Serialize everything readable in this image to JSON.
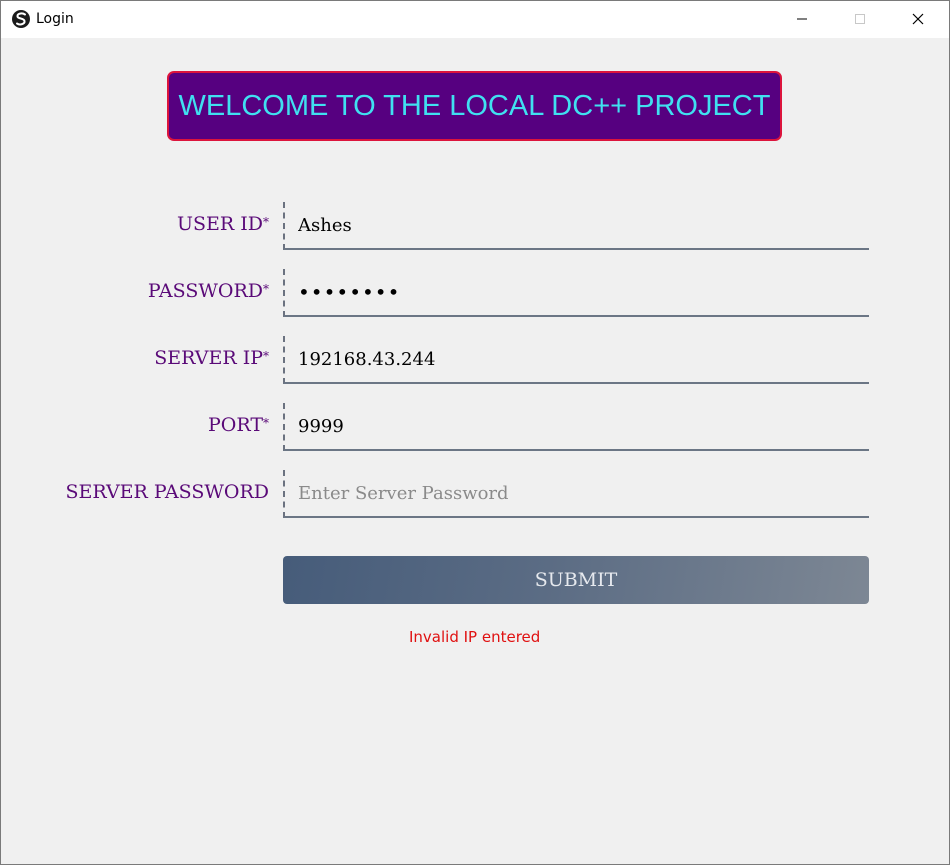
{
  "window": {
    "title": "Login",
    "app_icon": "swirl-logo-icon",
    "controls": {
      "minimize": "minimize-icon",
      "maximize": "maximize-icon",
      "close": "close-icon"
    }
  },
  "banner": {
    "text": "WELCOME TO THE LOCAL DC++ PROJECT"
  },
  "form": {
    "user_id": {
      "label": "USER ID",
      "required_mark": "*",
      "value": "Ashes",
      "placeholder": ""
    },
    "password": {
      "label": "PASSWORD",
      "required_mark": "*",
      "value": "••••••••",
      "placeholder": ""
    },
    "server_ip": {
      "label": "SERVER IP",
      "required_mark": "*",
      "value": "192168.43.244",
      "placeholder": ""
    },
    "port": {
      "label": "PORT",
      "required_mark": "*",
      "value": "9999",
      "placeholder": ""
    },
    "server_password": {
      "label": "SERVER PASSWORD",
      "value": "",
      "placeholder": "Enter Server Password"
    },
    "submit_label": "SUBMIT",
    "error_message": "Invalid IP entered"
  },
  "colors": {
    "banner_background": "#560080",
    "banner_border": "#dc143c",
    "banner_text": "#40e0f0",
    "label_text": "#5a0a78",
    "error_text": "#e01010",
    "submit_gradient_start": "#465c7a",
    "submit_gradient_end": "#7d8794"
  }
}
